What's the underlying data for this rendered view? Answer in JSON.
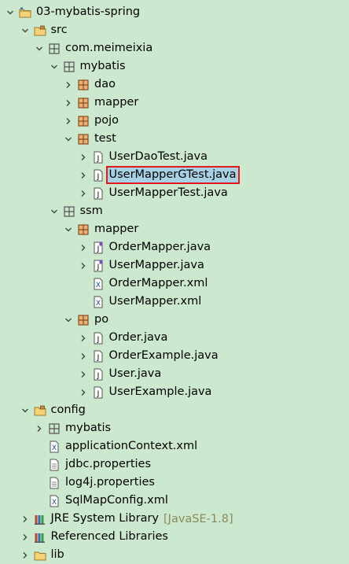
{
  "nodes": [
    {
      "label": "03-mybatis-spring",
      "depth": 0,
      "tw": "down",
      "icon": "project-icon",
      "name": "tree-item-project"
    },
    {
      "label": "src",
      "depth": 1,
      "tw": "down",
      "icon": "source-folder-icon",
      "name": "tree-item-src"
    },
    {
      "label": "com.meimeixia",
      "depth": 2,
      "tw": "down",
      "icon": "package-icon",
      "name": "tree-item-package-com-meimeixia"
    },
    {
      "label": "mybatis",
      "depth": 3,
      "tw": "down",
      "icon": "package-icon",
      "name": "tree-item-package-mybatis"
    },
    {
      "label": "dao",
      "depth": 4,
      "tw": "right",
      "icon": "package-filled-icon",
      "name": "tree-item-package-dao"
    },
    {
      "label": "mapper",
      "depth": 4,
      "tw": "right",
      "icon": "package-filled-icon",
      "name": "tree-item-package-mapper"
    },
    {
      "label": "pojo",
      "depth": 4,
      "tw": "right",
      "icon": "package-filled-icon",
      "name": "tree-item-package-pojo"
    },
    {
      "label": "test",
      "depth": 4,
      "tw": "down",
      "icon": "package-filled-icon",
      "name": "tree-item-package-test"
    },
    {
      "label": "UserDaoTest.java",
      "depth": 5,
      "tw": "right",
      "icon": "java-file-icon",
      "name": "tree-item-userdaotest"
    },
    {
      "label": "UserMapperGTest.java",
      "depth": 5,
      "tw": "right",
      "icon": "java-file-icon",
      "name": "tree-item-usermappergtest",
      "selected": true
    },
    {
      "label": "UserMapperTest.java",
      "depth": 5,
      "tw": "right",
      "icon": "java-file-icon",
      "name": "tree-item-usermappertest"
    },
    {
      "label": "ssm",
      "depth": 3,
      "tw": "down",
      "icon": "package-icon",
      "name": "tree-item-package-ssm"
    },
    {
      "label": "mapper",
      "depth": 4,
      "tw": "down",
      "icon": "package-filled-icon",
      "name": "tree-item-package-ssm-mapper"
    },
    {
      "label": "OrderMapper.java",
      "depth": 5,
      "tw": "right",
      "icon": "java-interface-icon",
      "name": "tree-item-ordermapper-java"
    },
    {
      "label": "UserMapper.java",
      "depth": 5,
      "tw": "right",
      "icon": "java-interface-icon",
      "name": "tree-item-usermapper-java"
    },
    {
      "label": "OrderMapper.xml",
      "depth": 5,
      "tw": "none",
      "icon": "xml-file-icon",
      "name": "tree-item-ordermapper-xml"
    },
    {
      "label": "UserMapper.xml",
      "depth": 5,
      "tw": "none",
      "icon": "xml-file-icon",
      "name": "tree-item-usermapper-xml"
    },
    {
      "label": "po",
      "depth": 4,
      "tw": "down",
      "icon": "package-filled-icon",
      "name": "tree-item-package-po"
    },
    {
      "label": "Order.java",
      "depth": 5,
      "tw": "right",
      "icon": "java-file-icon",
      "name": "tree-item-order-java"
    },
    {
      "label": "OrderExample.java",
      "depth": 5,
      "tw": "right",
      "icon": "java-file-icon",
      "name": "tree-item-orderexample-java"
    },
    {
      "label": "User.java",
      "depth": 5,
      "tw": "right",
      "icon": "java-file-icon",
      "name": "tree-item-user-java"
    },
    {
      "label": "UserExample.java",
      "depth": 5,
      "tw": "right",
      "icon": "java-file-icon",
      "name": "tree-item-userexample-java"
    },
    {
      "label": "config",
      "depth": 1,
      "tw": "down",
      "icon": "source-folder-icon",
      "name": "tree-item-config"
    },
    {
      "label": "mybatis",
      "depth": 2,
      "tw": "right",
      "icon": "package-icon",
      "name": "tree-item-config-mybatis"
    },
    {
      "label": "applicationContext.xml",
      "depth": 2,
      "tw": "none",
      "icon": "xml-file-icon",
      "name": "tree-item-applicationcontext-xml"
    },
    {
      "label": "jdbc.properties",
      "depth": 2,
      "tw": "none",
      "icon": "text-file-icon",
      "name": "tree-item-jdbc-properties"
    },
    {
      "label": "log4j.properties",
      "depth": 2,
      "tw": "none",
      "icon": "text-file-icon",
      "name": "tree-item-log4j-properties"
    },
    {
      "label": "SqlMapConfig.xml",
      "depth": 2,
      "tw": "none",
      "icon": "xml-file-icon",
      "name": "tree-item-sqlmapconfig-xml"
    },
    {
      "label": "JRE System Library",
      "depth": 1,
      "tw": "right",
      "icon": "library-icon",
      "name": "tree-item-jre-library",
      "decoration": "[JavaSE-1.8]"
    },
    {
      "label": "Referenced Libraries",
      "depth": 1,
      "tw": "right",
      "icon": "library-icon",
      "name": "tree-item-referenced-libraries"
    },
    {
      "label": "lib",
      "depth": 1,
      "tw": "right",
      "icon": "folder-icon",
      "name": "tree-item-lib"
    }
  ]
}
